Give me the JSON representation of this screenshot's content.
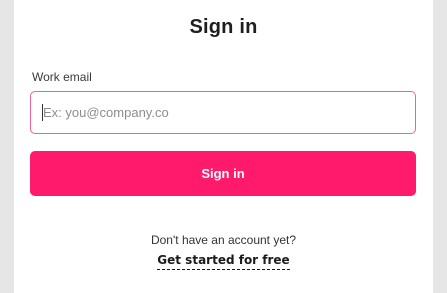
{
  "card": {
    "title": "Sign in"
  },
  "form": {
    "email_label": "Work email",
    "email_placeholder": "Ex: you@company.co",
    "email_value": "",
    "submit_label": "Sign in"
  },
  "footer": {
    "prompt_text": "Don't have an account yet?",
    "link_text": "Get started for free"
  },
  "colors": {
    "accent": "#ff1a6c",
    "input_border": "#f0628f",
    "page_background": "#e6e6e6",
    "card_background": "#ffffff"
  }
}
